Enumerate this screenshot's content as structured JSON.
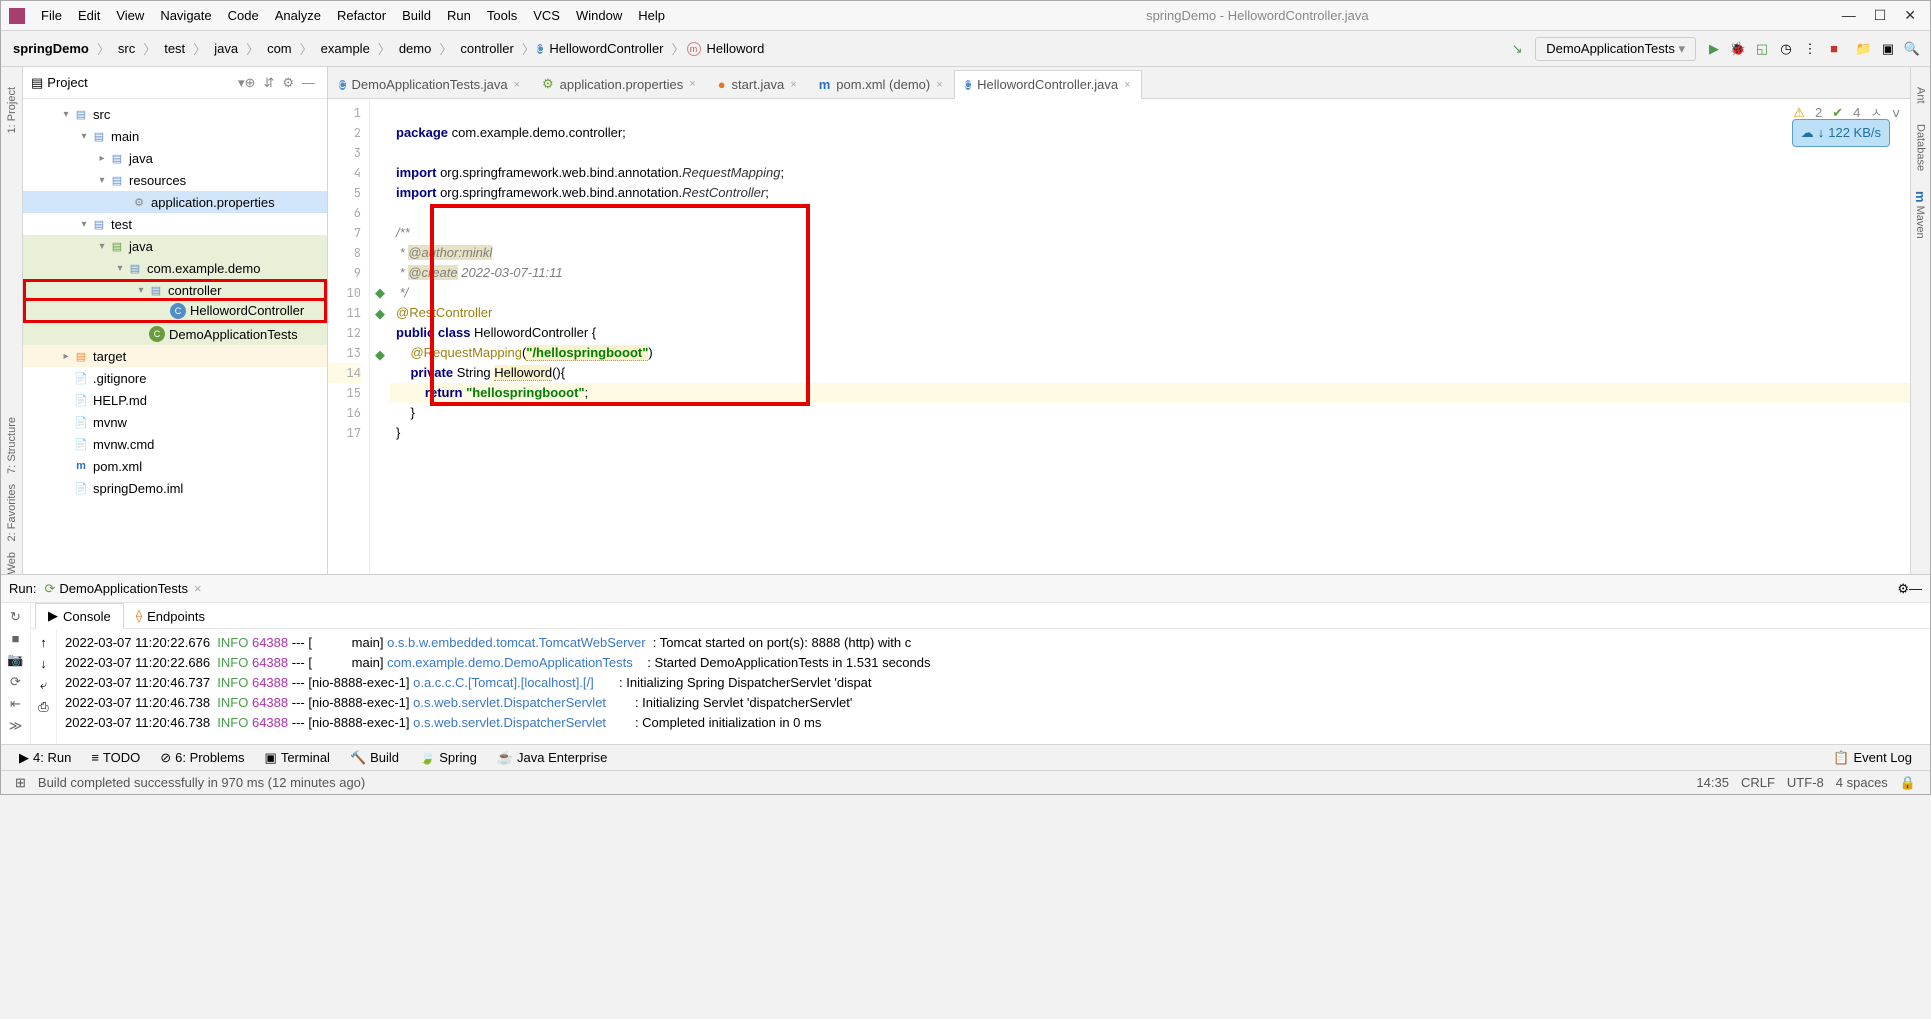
{
  "title": "springDemo - HellowordController.java",
  "menu": [
    "File",
    "Edit",
    "View",
    "Navigate",
    "Code",
    "Analyze",
    "Refactor",
    "Build",
    "Run",
    "Tools",
    "VCS",
    "Window",
    "Help"
  ],
  "breadcrumbs": [
    "springDemo",
    "src",
    "test",
    "java",
    "com",
    "example",
    "demo",
    "controller",
    "HellowordController",
    "Helloword"
  ],
  "run_config": "DemoApplicationTests",
  "project_label": "Project",
  "tree": {
    "src": "src",
    "main": "main",
    "java": "java",
    "resources": "resources",
    "appprops": "application.properties",
    "test": "test",
    "java2": "java",
    "pkg": "com.example.demo",
    "controller": "controller",
    "helloctrl": "HellowordController",
    "demotests": "DemoApplicationTests",
    "target": "target",
    "gitignore": ".gitignore",
    "help": "HELP.md",
    "mvnw": "mvnw",
    "mvnwcmd": "mvnw.cmd",
    "pom": "pom.xml",
    "iml": "springDemo.iml"
  },
  "tabs": [
    {
      "label": "DemoApplicationTests.java"
    },
    {
      "label": "application.properties"
    },
    {
      "label": "start.java"
    },
    {
      "label": "pom.xml (demo)"
    },
    {
      "label": "HellowordController.java"
    }
  ],
  "hints": {
    "warn": "2",
    "check": "4"
  },
  "badge": "122 KB/s",
  "code": {
    "l1a": "package",
    "l1b": " com.example.demo.controller;",
    "l3a": "import",
    "l3b": " org.springframework.web.bind.annotation.",
    "l3c": "RequestMapping",
    "l3d": ";",
    "l4a": "import",
    "l4b": " org.springframework.web.bind.annotation.",
    "l4c": "RestController",
    "l4d": ";",
    "l6": "/**",
    "l7a": " * ",
    "l7b": "@author:minkl",
    "l8a": " * ",
    "l8b": "@create",
    "l8c": " 2022-03-07-11:11",
    "l9": " */",
    "l10": "@RestController",
    "l11a": "public class",
    "l11b": " HellowordController {",
    "l12a": "    ",
    "l12b": "@RequestMapping",
    "l12c": "(",
    "l12d": "\"/hellospringbooot\"",
    "l12e": ")",
    "l13a": "    ",
    "l13b": "private",
    "l13c": " String ",
    "l13d": "Helloword",
    "l13e": "(){",
    "l14a": "        ",
    "l14b": "return ",
    "l14c": "\"hellospringbooot\"",
    "l14d": ";",
    "l15": "    }",
    "l16": "}"
  },
  "run_label": "Run:",
  "run_tab": "DemoApplicationTests",
  "console_tab": "Console",
  "endpoints_tab": "Endpoints",
  "logs": [
    {
      "ts": "2022-03-07 11:20:22.676",
      "lvl": "INFO",
      "pid": "64388",
      "th": "--- [           main] ",
      "src": "o.s.b.w.embedded.tomcat.TomcatWebServer ",
      "msg": ": Tomcat started on port(s): 8888 (http) with c"
    },
    {
      "ts": "2022-03-07 11:20:22.686",
      "lvl": "INFO",
      "pid": "64388",
      "th": "--- [           main] ",
      "src": "com.example.demo.DemoApplicationTests   ",
      "msg": ": Started DemoApplicationTests in 1.531 seconds"
    },
    {
      "ts": "2022-03-07 11:20:46.737",
      "lvl": "INFO",
      "pid": "64388",
      "th": "--- [nio-8888-exec-1] ",
      "src": "o.a.c.c.C.[Tomcat].[localhost].[/]      ",
      "msg": ": Initializing Spring DispatcherServlet 'dispat"
    },
    {
      "ts": "2022-03-07 11:20:46.738",
      "lvl": "INFO",
      "pid": "64388",
      "th": "--- [nio-8888-exec-1] ",
      "src": "o.s.web.servlet.DispatcherServlet       ",
      "msg": ": Initializing Servlet 'dispatcherServlet'"
    },
    {
      "ts": "2022-03-07 11:20:46.738",
      "lvl": "INFO",
      "pid": "64388",
      "th": "--- [nio-8888-exec-1] ",
      "src": "o.s.web.servlet.DispatcherServlet       ",
      "msg": ": Completed initialization in 0 ms"
    }
  ],
  "bottom": [
    "4: Run",
    "TODO",
    "6: Problems",
    "Terminal",
    "Build",
    "Spring",
    "Java Enterprise"
  ],
  "eventlog": "Event Log",
  "status_msg": "Build completed successfully in 970 ms (12 minutes ago)",
  "status_right": {
    "time": "14:35",
    "crlf": "CRLF",
    "enc": "UTF-8",
    "spaces": "4 spaces"
  }
}
